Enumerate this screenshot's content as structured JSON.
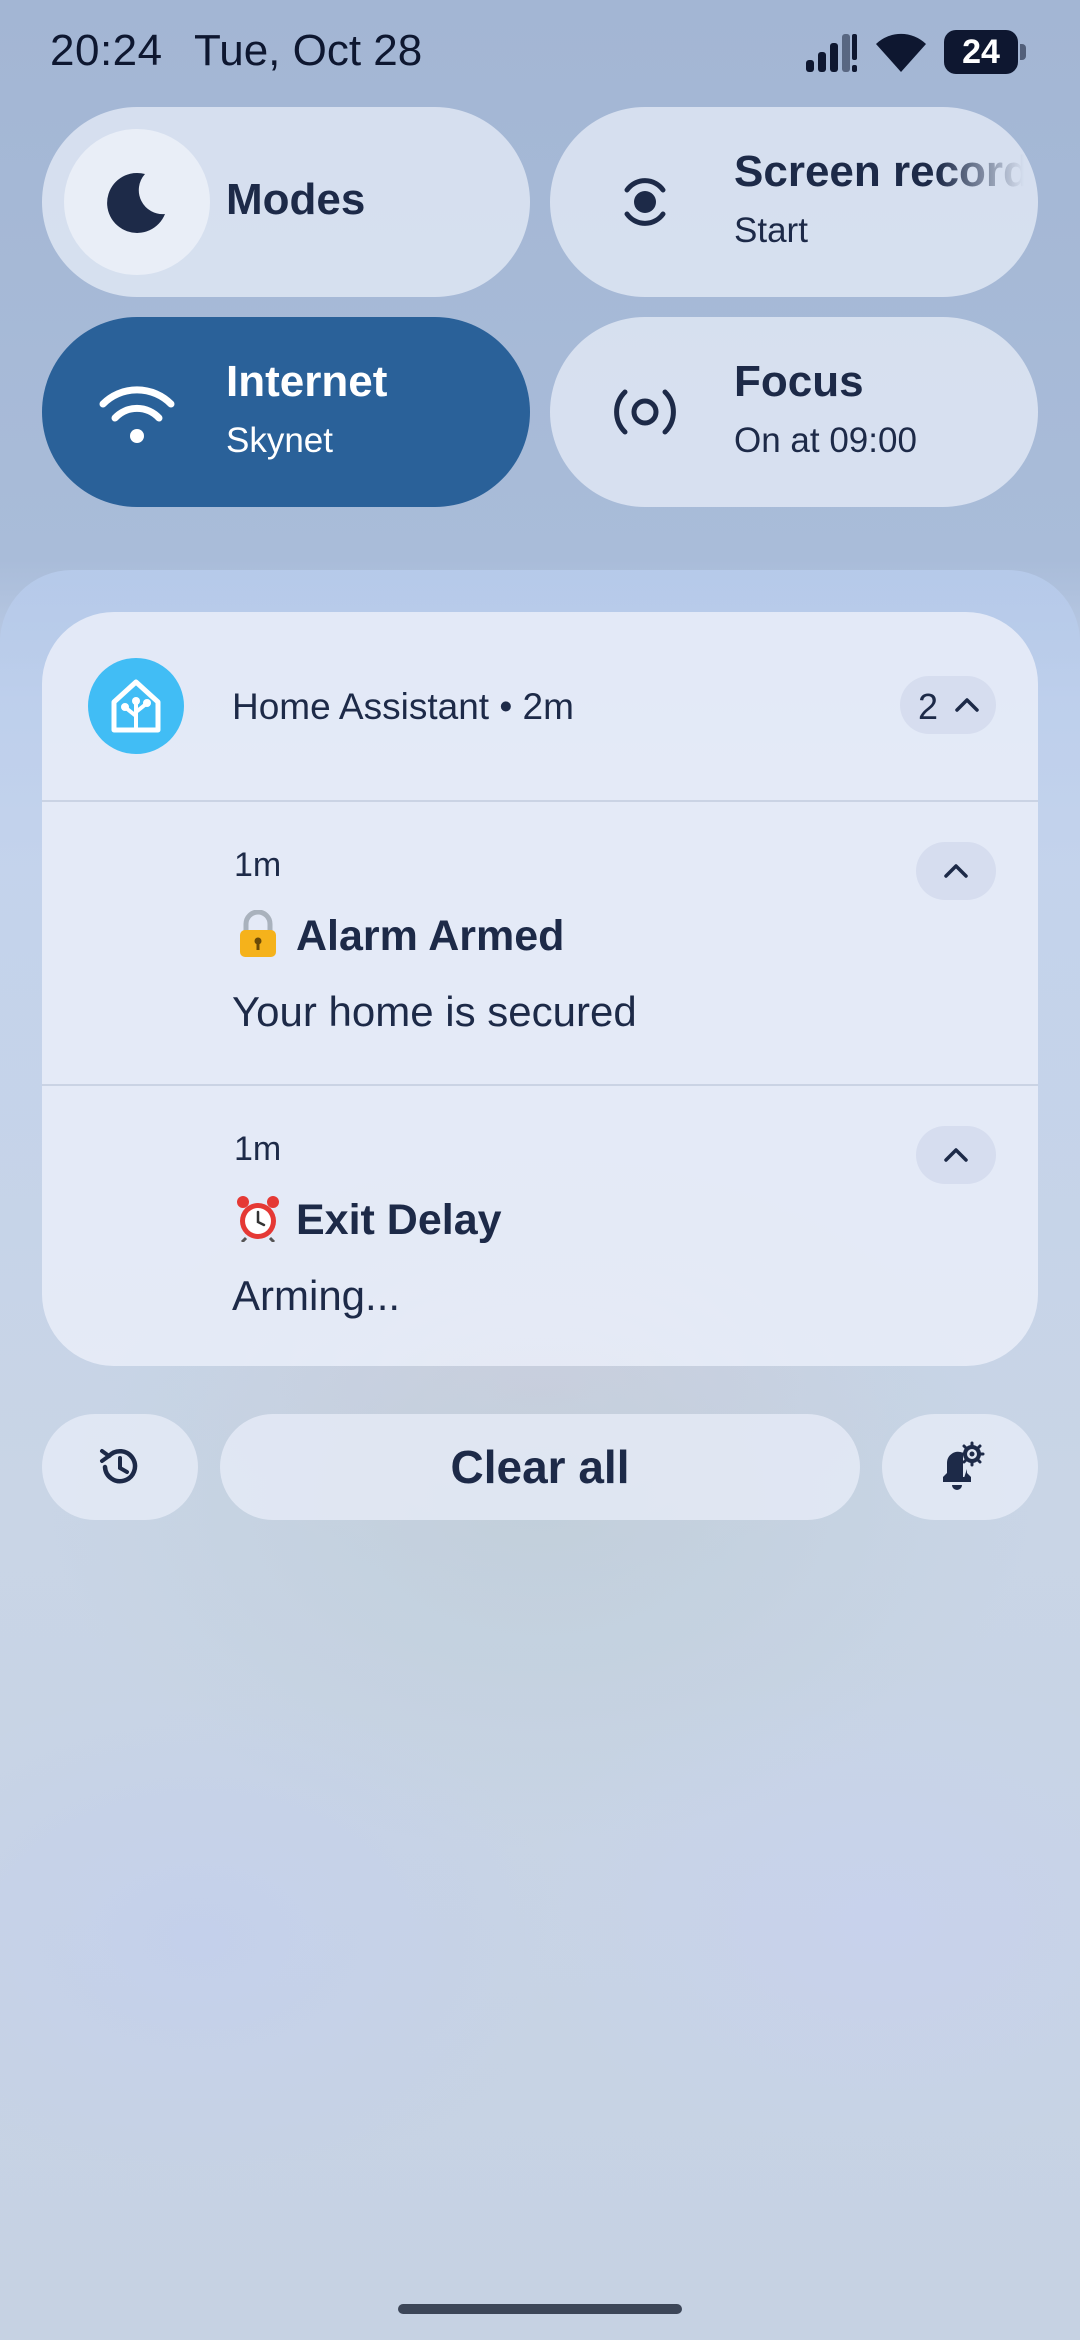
{
  "status_bar": {
    "time": "20:24",
    "date": "Tue, Oct 28",
    "battery": "24",
    "icons": [
      "signal-icon",
      "wifi-icon",
      "battery-icon"
    ]
  },
  "quick_settings": {
    "modes": {
      "label": "Modes",
      "icon": "moon-icon"
    },
    "screen_record": {
      "label": "Screen record",
      "sublabel": "Start",
      "icon": "screen-record-icon"
    },
    "internet": {
      "label": "Internet",
      "sublabel": "Skynet",
      "icon": "wifi-icon",
      "active": true
    },
    "focus": {
      "label": "Focus",
      "sublabel": "On at 09:00",
      "icon": "focus-icon"
    }
  },
  "notification": {
    "app": "Home Assistant • 2m",
    "app_icon": "home-assistant-icon",
    "count": "2",
    "items": [
      {
        "time": "1m",
        "emoji": "lock-icon",
        "title": "Alarm Armed",
        "body": "Your home is secured"
      },
      {
        "time": "1m",
        "emoji": "alarm-clock-icon",
        "title": "Exit Delay",
        "body": "Arming..."
      }
    ]
  },
  "actions": {
    "history_icon": "history-icon",
    "clear_all": "Clear all",
    "settings_icon": "notification-settings-icon"
  },
  "colors": {
    "active_tile": "#2a6199",
    "app_accent": "#41bdf5",
    "text": "#1d2a48"
  }
}
